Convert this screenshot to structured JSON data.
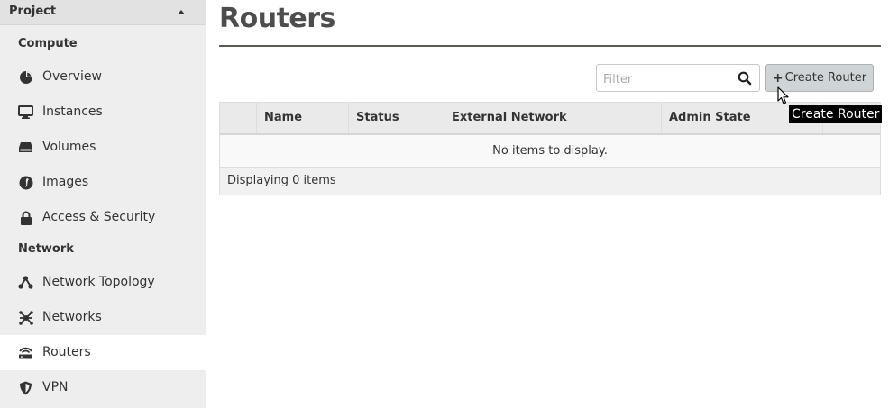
{
  "sidebar": {
    "project_label": "Project",
    "compute_label": "Compute",
    "compute_items": [
      {
        "label": "Overview",
        "icon": "pie-chart-icon"
      },
      {
        "label": "Instances",
        "icon": "monitor-icon"
      },
      {
        "label": "Volumes",
        "icon": "hard-drive-icon"
      },
      {
        "label": "Images",
        "icon": "image-icon"
      },
      {
        "label": "Access & Security",
        "icon": "lock-icon"
      }
    ],
    "network_label": "Network",
    "network_items": [
      {
        "label": "Network Topology",
        "icon": "topology-icon"
      },
      {
        "label": "Networks",
        "icon": "network-icon"
      },
      {
        "label": "Routers",
        "icon": "router-icon",
        "active": true
      },
      {
        "label": "VPN",
        "icon": "shield-icon"
      }
    ]
  },
  "main": {
    "title": "Routers",
    "filter_placeholder": "Filter",
    "create_button_label": "Create Router",
    "tooltip": "Create Router",
    "table": {
      "columns": [
        "",
        "Name",
        "Status",
        "External Network",
        "Admin State",
        ""
      ],
      "empty_message": "No items to display.",
      "footer": "Displaying 0 items"
    }
  },
  "colors": {
    "sidebar_bg": "#eeeeee",
    "active_bg": "#ffffff",
    "button_bg": "#cfd4d6",
    "title_color": "#4d4d4d"
  }
}
